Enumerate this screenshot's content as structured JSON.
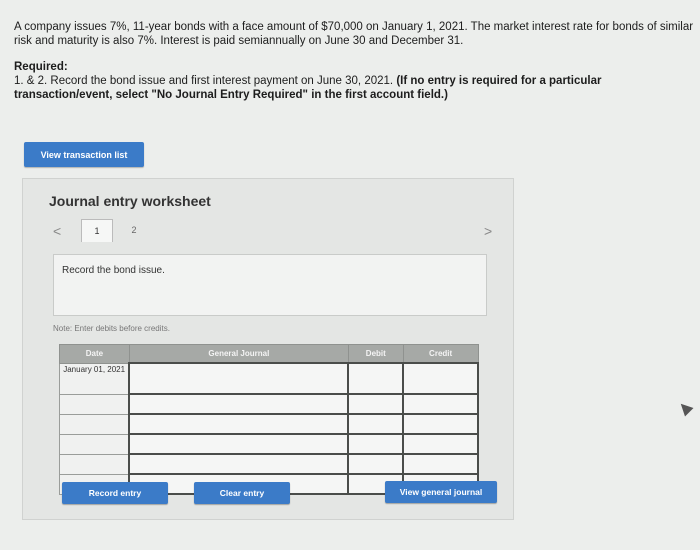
{
  "problem": {
    "line1": "A company issues 7%, 11-year bonds with a face amount of $70,000 on January 1, 2021. The market interest rate for bonds of similar",
    "line2": "risk and maturity is also 7%. Interest is paid semiannually on June 30 and December 31.",
    "required_heading": "Required:",
    "required_text": "1. & 2. Record the bond issue and first interest payment on June 30, 2021.",
    "required_note": "(If no entry is required for a particular transaction/event, select \"No Journal Entry Required\" in the first account field.)"
  },
  "buttons": {
    "view_transaction_list": "View transaction list",
    "record_entry": "Record entry",
    "clear_entry": "Clear entry",
    "view_general_journal": "View general journal"
  },
  "worksheet": {
    "title": "Journal entry worksheet",
    "nav_prev": "<",
    "nav_next": ">",
    "tabs": [
      {
        "label": "1"
      },
      {
        "label": "2"
      }
    ],
    "active_tab": "1",
    "instruction": "Record the bond issue.",
    "note": "Note: Enter debits before credits."
  },
  "journal": {
    "headers": {
      "date": "Date",
      "account": "General Journal",
      "debit": "Debit",
      "credit": "Credit"
    },
    "rows": [
      {
        "date": "January 01, 2021",
        "account": "",
        "debit": "",
        "credit": ""
      },
      {
        "date": "",
        "account": "",
        "debit": "",
        "credit": ""
      },
      {
        "date": "",
        "account": "",
        "debit": "",
        "credit": ""
      },
      {
        "date": "",
        "account": "",
        "debit": "",
        "credit": ""
      },
      {
        "date": "",
        "account": "",
        "debit": "",
        "credit": ""
      },
      {
        "date": "",
        "account": "",
        "debit": "",
        "credit": ""
      }
    ]
  },
  "colors": {
    "accent": "#3b7bc8",
    "header": "#a6a9a6"
  }
}
